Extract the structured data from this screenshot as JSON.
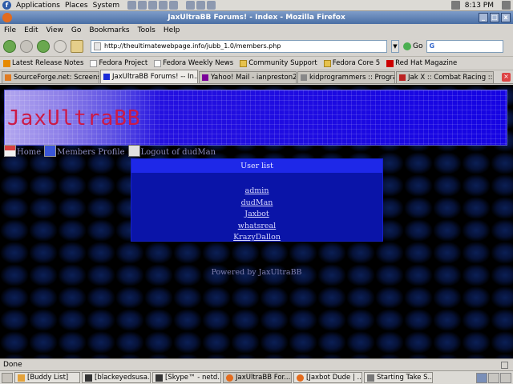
{
  "panel": {
    "menus": [
      "Applications",
      "Places",
      "System"
    ],
    "clock": "8:13 PM"
  },
  "window": {
    "title": "JaxUltraBB Forums! - Index - Mozilla Firefox"
  },
  "menubar": [
    "File",
    "Edit",
    "View",
    "Go",
    "Bookmarks",
    "Tools",
    "Help"
  ],
  "navbar": {
    "url": "http://theultimatewebpage.info/jubb_1.0/members.php",
    "go_label": "Go",
    "search_value": "",
    "search_engine": "G"
  },
  "bookmarks": [
    {
      "label": "Latest Release Notes",
      "icon": "rss-icon"
    },
    {
      "label": "Fedora Project",
      "icon": "page-icon"
    },
    {
      "label": "Fedora Weekly News",
      "icon": "page-icon"
    },
    {
      "label": "Community Support",
      "icon": "folder-icon"
    },
    {
      "label": "Fedora Core 5",
      "icon": "folder-icon"
    },
    {
      "label": "Red Hat Magazine",
      "icon": "redhat-icon"
    }
  ],
  "tabs": [
    {
      "label": "SourceForge.net: Screensh..."
    },
    {
      "label": "JaxUltraBB Forums! -- In..."
    },
    {
      "label": "Yahoo! Mail - ianpreston20..."
    },
    {
      "label": "kidprogrammers :: Program..."
    },
    {
      "label": "Jak X :: Combat Racing :: ..."
    }
  ],
  "page": {
    "banner_title": "JaxUltraBB",
    "nav": {
      "home": "Home",
      "profile": "Members Profile",
      "logout": "Logout of dudMan"
    },
    "userlist": {
      "header": "User list",
      "users": [
        "admin",
        "dudMan",
        "Jaxbot",
        "whatsreal",
        "KrazyDallon"
      ]
    },
    "powered_by": "Powered by JaxUltraBB"
  },
  "status": "Done",
  "taskbar": [
    {
      "label": "[Buddy List]",
      "icon": "gaim-icon"
    },
    {
      "label": "[blackeyedsusa...",
      "icon": "terminal-icon"
    },
    {
      "label": "[Skype™ - netd...",
      "icon": "terminal-icon"
    },
    {
      "label": "JaxUltraBB For...",
      "icon": "firefox-icon"
    },
    {
      "label": "[Jaxbot Dude | ...",
      "icon": "firefox-icon"
    },
    {
      "label": "Starting Take S...",
      "icon": "screenshot-icon"
    }
  ]
}
